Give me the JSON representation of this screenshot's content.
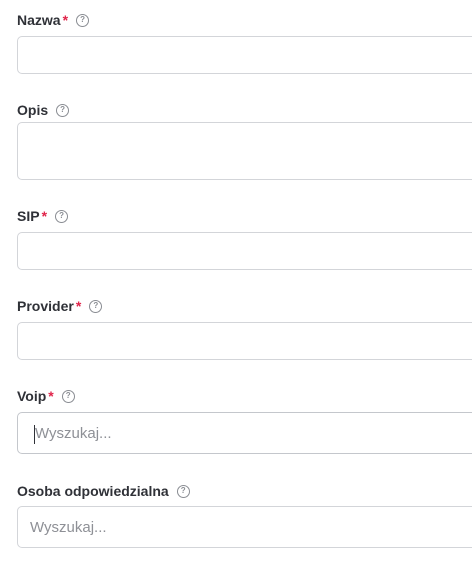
{
  "fields": {
    "nazwa": {
      "label": "Nazwa",
      "required_mark": "*",
      "help": "?",
      "value": ""
    },
    "opis": {
      "label": "Opis",
      "help": "?",
      "value": ""
    },
    "sip": {
      "label": "SIP",
      "required_mark": "*",
      "help": "?",
      "value": ""
    },
    "provider": {
      "label": "Provider",
      "required_mark": "*",
      "help": "?",
      "value": ""
    },
    "voip": {
      "label": "Voip",
      "required_mark": "*",
      "help": "?",
      "placeholder": "Wyszukaj...",
      "value": ""
    },
    "osoba": {
      "label": "Osoba odpowiedzialna",
      "help": "?",
      "placeholder": "Wyszukaj...",
      "value": ""
    }
  },
  "colors": {
    "required": "#e0244a",
    "border": "#d3d5d9",
    "label": "#2f3137",
    "placeholder": "#8e9096"
  }
}
